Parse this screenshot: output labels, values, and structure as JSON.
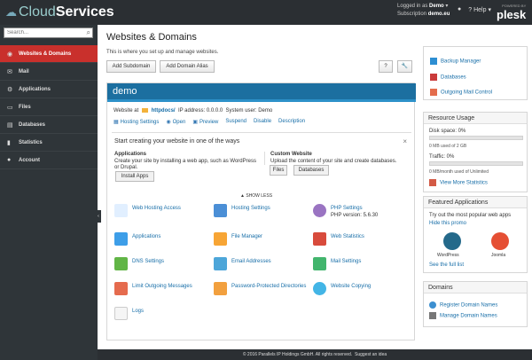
{
  "header": {
    "brand_prefix": "Cloud",
    "brand_suffix": "Services",
    "logged_in_label": "Logged in as",
    "logged_in_value": "Demo",
    "subscription_label": "Subscription",
    "subscription_value": "demo.eu",
    "profile_icon": "profile-icon",
    "help_label": "Help",
    "powered_by": "POWERED BY",
    "plesk": "plesk"
  },
  "sidebar": {
    "search_placeholder": "Search...",
    "items": [
      {
        "label": "Websites & Domains",
        "icon": "globe-icon"
      },
      {
        "label": "Mail",
        "icon": "mail-icon"
      },
      {
        "label": "Applications",
        "icon": "applications-icon"
      },
      {
        "label": "Files",
        "icon": "folder-icon"
      },
      {
        "label": "Databases",
        "icon": "database-icon"
      },
      {
        "label": "Statistics",
        "icon": "statistics-icon"
      },
      {
        "label": "Account",
        "icon": "account-icon"
      }
    ]
  },
  "main": {
    "title": "Websites & Domains",
    "subtitle": "This is where you set up and manage websites.",
    "buttons": {
      "add_subdomain": "Add Subdomain",
      "add_domain_alias": "Add Domain Alias",
      "help": "?",
      "settings": "🔧"
    },
    "domain": {
      "name": "demo",
      "website_at": "Website at",
      "httpdocs": "httpdocs/",
      "ip": "IP address: 0.0.0.0",
      "system_user": "System user: Demo",
      "actions": [
        "Hosting Settings",
        "Open",
        "Preview",
        "Suspend",
        "Disable",
        "Description"
      ]
    },
    "start": {
      "title": "Start creating your website in one of the ways",
      "applications_title": "Applications",
      "applications_desc": "Create your site by installing a web app, such as WordPress or Drupal.",
      "install_apps": "Install Apps",
      "custom_title": "Custom Website",
      "custom_desc": "Upload the content of your site and create databases.",
      "files": "Files",
      "databases": "Databases"
    },
    "show_less": "▲ SHOW LESS",
    "tools": [
      {
        "label": "Web Hosting Access",
        "icon": "web-hosting-access-icon"
      },
      {
        "label": "Hosting Settings",
        "icon": "hosting-settings-icon"
      },
      {
        "label": "PHP Settings",
        "sub": "PHP version: 5.6.30",
        "icon": "php-settings-icon"
      },
      {
        "label": "Applications",
        "icon": "applications-icon"
      },
      {
        "label": "File Manager",
        "icon": "file-manager-icon"
      },
      {
        "label": "Web Statistics",
        "icon": "web-statistics-icon"
      },
      {
        "label": "DNS Settings",
        "icon": "dns-settings-icon"
      },
      {
        "label": "Email Addresses",
        "icon": "email-addresses-icon"
      },
      {
        "label": "Mail Settings",
        "icon": "mail-settings-icon"
      },
      {
        "label": "Limit Outgoing Messages",
        "icon": "limit-outgoing-messages-icon"
      },
      {
        "label": "Password-Protected Directories",
        "icon": "password-protected-directories-icon"
      },
      {
        "label": "Website Copying",
        "icon": "website-copying-icon"
      },
      {
        "label": "Logs",
        "icon": "logs-icon"
      }
    ]
  },
  "right": {
    "quick_links": [
      "Backup Manager",
      "Databases",
      "Outgoing Mail Control"
    ],
    "resource_title": "Resource Usage",
    "disk_label": "Disk space: 0%",
    "disk_value": "0 MB used of 2 GB",
    "traffic_label": "Traffic: 0%",
    "traffic_value": "0 MB/month used of Unlimited",
    "view_stats": "View More Statistics",
    "featured_title": "Featured Applications",
    "featured_text": "Try out the most popular web apps",
    "hide_promo": "Hide this promo",
    "apps": [
      "WordPress",
      "Joomla"
    ],
    "full_list": "See the full list",
    "domains_title": "Domains",
    "domain_links": [
      "Register Domain Names",
      "Manage Domain Names"
    ]
  },
  "footer": {
    "copyright": "© 2016 Parallels IP Holdings GmbH. All rights reserved.",
    "suggest": "Suggest an idea"
  }
}
